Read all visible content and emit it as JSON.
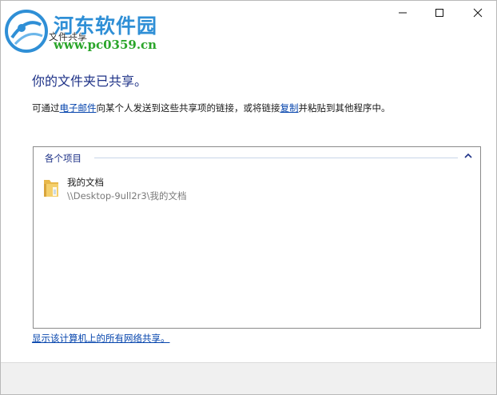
{
  "watermark": {
    "site_name": "河东软件园",
    "url": "www.pc0359.cn"
  },
  "window": {
    "title": "文件共享",
    "minimize_glyph": "—",
    "maximize_glyph": "☐",
    "close_glyph": "✕"
  },
  "content": {
    "heading": "你的文件夹已共享。",
    "desc_before": "可通过",
    "email_link": "电子邮件",
    "desc_middle": "向某个人发送到这些共享项的链接，或将链接",
    "copy_link": "复制",
    "desc_after": "并粘贴到其他程序中。"
  },
  "items_group": {
    "title": "各个项目",
    "collapsed": false,
    "items": [
      {
        "name": "我的文档",
        "path": "\\\\Desktop-9ull2r3\\我的文档",
        "icon": "folder-icon"
      }
    ]
  },
  "footer_link": "显示该计算机上的所有网络共享。",
  "colors": {
    "heading": "#1e3287",
    "link": "#0645ad",
    "watermark_title": "#2f8fd6",
    "watermark_url": "#2aa52a"
  }
}
